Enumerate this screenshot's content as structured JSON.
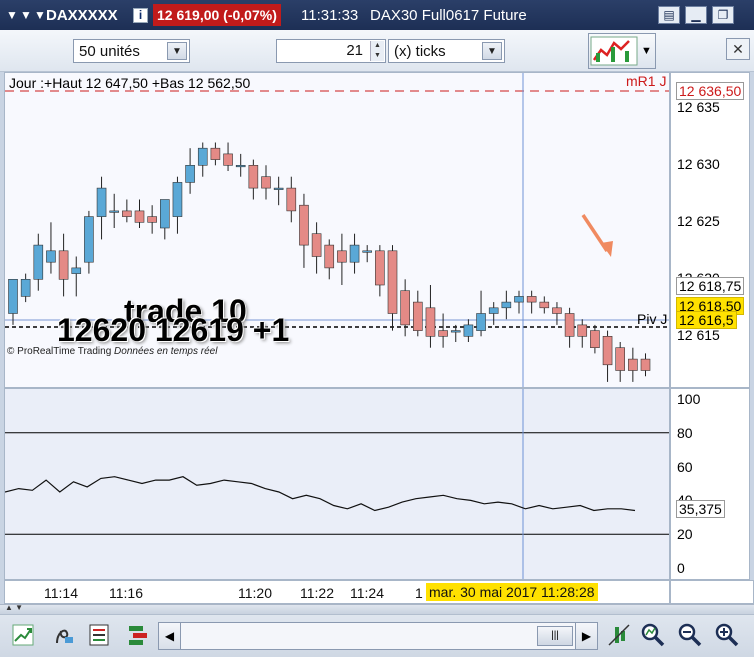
{
  "window": {
    "instrument": "DAXXXXX",
    "info_symbol": "i",
    "price_change": "12 619,00 (-0,07%)",
    "time": "11:31:33",
    "title": "DAX30 Full0617 Future",
    "dropdown_glyph": "▼"
  },
  "toolbar": {
    "units": {
      "value": "50 unités"
    },
    "ticks_count": "21",
    "ticks_unit": {
      "value": "(x) ticks"
    },
    "close_glyph": "✕"
  },
  "price_pane": {
    "header": "Jour :+Haut 12 647,50 +Bas 12 562,50",
    "level_r1": "mR1 J",
    "level_piv": "Piv J",
    "copyright": "© ProRealTime Trading",
    "realtime": "Données en temps réel",
    "annotation_line1": "trade 10",
    "annotation_line2": "12620 12619 +1",
    "axis_ticks": [
      "12 635",
      "12 630",
      "12 625",
      "12 620",
      "12 615"
    ],
    "price_tags": [
      {
        "text": "12 636,50",
        "color": "#cc1a1a",
        "bg": "#ffffff"
      },
      {
        "text": "12 618,75",
        "color": "#000000",
        "bg": "#ffffff"
      },
      {
        "text": "12 618,50",
        "color": "#000000",
        "bg": "#ffe100"
      },
      {
        "text": "12 616,5",
        "color": "#000000",
        "bg": "#ffe100"
      }
    ],
    "candles": [
      {
        "o": 12622.5,
        "h": 12625.5,
        "l": 12621.5,
        "c": 12625.5
      },
      {
        "o": 12624.0,
        "h": 12626.0,
        "l": 12623.5,
        "c": 12625.5
      },
      {
        "o": 12625.5,
        "h": 12629.5,
        "l": 12624.5,
        "c": 12628.5
      },
      {
        "o": 12627.0,
        "h": 12630.5,
        "l": 12626.0,
        "c": 12628.0
      },
      {
        "o": 12628.0,
        "h": 12629.5,
        "l": 12624.0,
        "c": 12625.5
      },
      {
        "o": 12626.0,
        "h": 12627.5,
        "l": 12624.0,
        "c": 12626.5
      },
      {
        "o": 12627.0,
        "h": 12631.5,
        "l": 12626.0,
        "c": 12631.0
      },
      {
        "o": 12631.0,
        "h": 12634.5,
        "l": 12629.0,
        "c": 12633.5
      },
      {
        "o": 12631.5,
        "h": 12633.0,
        "l": 12630.0,
        "c": 12631.5
      },
      {
        "o": 12631.5,
        "h": 12632.5,
        "l": 12630.5,
        "c": 12631.0
      },
      {
        "o": 12631.5,
        "h": 12632.5,
        "l": 12630.0,
        "c": 12630.5
      },
      {
        "o": 12631.0,
        "h": 12632.0,
        "l": 12629.5,
        "c": 12630.5
      },
      {
        "o": 12630.0,
        "h": 12632.0,
        "l": 12629.0,
        "c": 12632.5
      },
      {
        "o": 12631.0,
        "h": 12634.5,
        "l": 12629.5,
        "c": 12634.0
      },
      {
        "o": 12634.0,
        "h": 12637.0,
        "l": 12633.0,
        "c": 12635.5
      },
      {
        "o": 12635.5,
        "h": 12637.5,
        "l": 12634.5,
        "c": 12637.0
      },
      {
        "o": 12637.0,
        "h": 12637.5,
        "l": 12635.5,
        "c": 12636.0
      },
      {
        "o": 12636.5,
        "h": 12637.5,
        "l": 12635.0,
        "c": 12635.5
      },
      {
        "o": 12635.5,
        "h": 12636.5,
        "l": 12634.5,
        "c": 12635.5
      },
      {
        "o": 12635.5,
        "h": 12636.0,
        "l": 12632.5,
        "c": 12633.5
      },
      {
        "o": 12634.5,
        "h": 12635.5,
        "l": 12632.5,
        "c": 12633.5
      },
      {
        "o": 12633.5,
        "h": 12634.5,
        "l": 12632.0,
        "c": 12633.5
      },
      {
        "o": 12633.5,
        "h": 12634.5,
        "l": 12630.5,
        "c": 12631.5
      },
      {
        "o": 12632.0,
        "h": 12633.0,
        "l": 12626.5,
        "c": 12628.5
      },
      {
        "o": 12629.5,
        "h": 12630.5,
        "l": 12626.0,
        "c": 12627.5
      },
      {
        "o": 12628.5,
        "h": 12629.0,
        "l": 12625.5,
        "c": 12626.5
      },
      {
        "o": 12628.0,
        "h": 12629.5,
        "l": 12625.0,
        "c": 12627.0
      },
      {
        "o": 12627.0,
        "h": 12629.5,
        "l": 12626.0,
        "c": 12628.5
      },
      {
        "o": 12628.0,
        "h": 12628.5,
        "l": 12627.0,
        "c": 12628.0
      },
      {
        "o": 12628.0,
        "h": 12628.5,
        "l": 12624.0,
        "c": 12625.0
      },
      {
        "o": 12628.0,
        "h": 12628.5,
        "l": 12621.0,
        "c": 12622.5
      },
      {
        "o": 12624.5,
        "h": 12625.5,
        "l": 12620.5,
        "c": 12621.5
      },
      {
        "o": 12623.5,
        "h": 12624.5,
        "l": 12620.5,
        "c": 12621.0
      },
      {
        "o": 12623.0,
        "h": 12625.0,
        "l": 12619.5,
        "c": 12620.5
      },
      {
        "o": 12621.0,
        "h": 12622.5,
        "l": 12619.5,
        "c": 12620.5
      },
      {
        "o": 12621.0,
        "h": 12621.5,
        "l": 12620.0,
        "c": 12621.0
      },
      {
        "o": 12620.5,
        "h": 12622.0,
        "l": 12620.0,
        "c": 12621.5
      },
      {
        "o": 12621.0,
        "h": 12624.5,
        "l": 12620.5,
        "c": 12622.5
      },
      {
        "o": 12622.5,
        "h": 12623.5,
        "l": 12621.5,
        "c": 12623.0
      },
      {
        "o": 12623.0,
        "h": 12624.5,
        "l": 12622.0,
        "c": 12623.5
      },
      {
        "o": 12623.5,
        "h": 12624.5,
        "l": 12622.5,
        "c": 12624.0
      },
      {
        "o": 12624.0,
        "h": 12624.5,
        "l": 12622.5,
        "c": 12623.5
      },
      {
        "o": 12623.5,
        "h": 12624.0,
        "l": 12622.5,
        "c": 12623.0
      },
      {
        "o": 12623.0,
        "h": 12623.5,
        "l": 12621.5,
        "c": 12622.5
      },
      {
        "o": 12622.5,
        "h": 12623.0,
        "l": 12619.5,
        "c": 12620.5
      },
      {
        "o": 12621.5,
        "h": 12622.0,
        "l": 12619.5,
        "c": 12620.5
      },
      {
        "o": 12621.0,
        "h": 12621.5,
        "l": 12619.0,
        "c": 12619.5
      },
      {
        "o": 12620.5,
        "h": 12621.0,
        "l": 12616.5,
        "c": 12618.0
      },
      {
        "o": 12619.5,
        "h": 12620.0,
        "l": 12616.5,
        "c": 12617.5
      },
      {
        "o": 12618.5,
        "h": 12619.5,
        "l": 12616.5,
        "c": 12617.5
      },
      {
        "o": 12618.5,
        "h": 12619.0,
        "l": 12617.0,
        "c": 12617.5
      }
    ]
  },
  "osc_pane": {
    "axis_ticks": [
      "100",
      "80",
      "60",
      "40",
      "20",
      "0"
    ],
    "value_tag": "35,375",
    "values": [
      45,
      47,
      46,
      52,
      45,
      51,
      48,
      53,
      54,
      52,
      50,
      52,
      52,
      54,
      49,
      50,
      52,
      51,
      50,
      47,
      45,
      41,
      43,
      41,
      37,
      35,
      38,
      34,
      36,
      39,
      41,
      42,
      43,
      41,
      40,
      38,
      39,
      38,
      35,
      37,
      35,
      36,
      37,
      34,
      35,
      35,
      34
    ]
  },
  "time_axis": {
    "labels": [
      "11:14",
      "11:16",
      "11:20",
      "11:22",
      "11:24",
      "1"
    ],
    "cursor_label": "mar. 30 mai 2017 11:28:28"
  },
  "colors": {
    "up": "#5aa8d6",
    "down": "#e48a86",
    "accent": "#1d2f55",
    "cursor": "#6f93d6"
  },
  "bottom_icons": [
    "chart-type-icon",
    "draw-tool-icon",
    "indicator-list-icon",
    "object-list-icon",
    "scroll-left-icon",
    "scrollbar-thumb",
    "scroll-right-icon",
    "expand-icon",
    "zoom-fit-icon",
    "zoom-out-icon",
    "zoom-in-icon"
  ]
}
